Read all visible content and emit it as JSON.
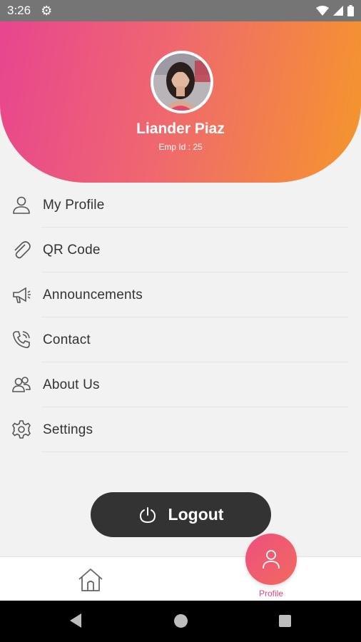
{
  "status_bar": {
    "time": "3:26",
    "icons": [
      "gear-icon",
      "wifi-icon",
      "signal-icon",
      "battery-icon"
    ]
  },
  "profile": {
    "name": "Liander Piaz",
    "emp_id": "Emp Id : 25"
  },
  "menu": [
    {
      "label": "My Profile",
      "icon": "person-icon"
    },
    {
      "label": "QR Code",
      "icon": "paperclip-icon"
    },
    {
      "label": "Announcements",
      "icon": "megaphone-icon"
    },
    {
      "label": "Contact",
      "icon": "phone-icon"
    },
    {
      "label": "About Us",
      "icon": "group-icon"
    },
    {
      "label": "Settings",
      "icon": "gear-icon"
    }
  ],
  "logout": {
    "label": "Logout",
    "icon": "power-icon"
  },
  "bottom_nav": {
    "home_icon": "home-icon",
    "profile_label": "Profile"
  },
  "colors": {
    "gradient_start": "#e8458f",
    "gradient_end": "#f5962c",
    "accent": "#e8457f",
    "dark_button": "#333333"
  }
}
